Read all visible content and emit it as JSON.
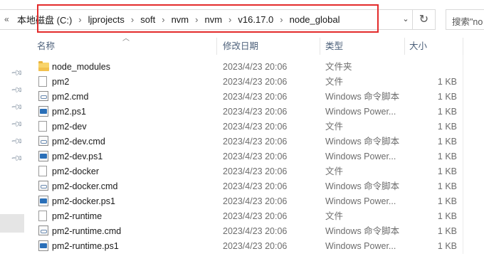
{
  "address_bar": {
    "overflow_glyph": "«",
    "crumbs": [
      "本地磁盘 (C:)",
      "ljprojects",
      "soft",
      "nvm",
      "nvm",
      "v16.17.0",
      "node_global"
    ],
    "separator": "›",
    "dropdown_glyph": "⌄",
    "refresh_glyph": "↻"
  },
  "search": {
    "placeholder": "搜索\"no"
  },
  "columns": {
    "name": "名称",
    "date": "修改日期",
    "type": "类型",
    "size": "大小"
  },
  "files": [
    {
      "name": "node_modules",
      "date": "2023/4/23 20:06",
      "type": "文件夹",
      "size": "",
      "icon": "folder-icon"
    },
    {
      "name": "pm2",
      "date": "2023/4/23 20:06",
      "type": "文件",
      "size": "1 KB",
      "icon": "file-icon"
    },
    {
      "name": "pm2.cmd",
      "date": "2023/4/23 20:06",
      "type": "Windows 命令脚本",
      "size": "1 KB",
      "icon": "cmd-script-icon"
    },
    {
      "name": "pm2.ps1",
      "date": "2023/4/23 20:06",
      "type": "Windows Power...",
      "size": "1 KB",
      "icon": "powershell-icon"
    },
    {
      "name": "pm2-dev",
      "date": "2023/4/23 20:06",
      "type": "文件",
      "size": "1 KB",
      "icon": "file-icon"
    },
    {
      "name": "pm2-dev.cmd",
      "date": "2023/4/23 20:06",
      "type": "Windows 命令脚本",
      "size": "1 KB",
      "icon": "cmd-script-icon"
    },
    {
      "name": "pm2-dev.ps1",
      "date": "2023/4/23 20:06",
      "type": "Windows Power...",
      "size": "1 KB",
      "icon": "powershell-icon"
    },
    {
      "name": "pm2-docker",
      "date": "2023/4/23 20:06",
      "type": "文件",
      "size": "1 KB",
      "icon": "file-icon"
    },
    {
      "name": "pm2-docker.cmd",
      "date": "2023/4/23 20:06",
      "type": "Windows 命令脚本",
      "size": "1 KB",
      "icon": "cmd-script-icon"
    },
    {
      "name": "pm2-docker.ps1",
      "date": "2023/4/23 20:06",
      "type": "Windows Power...",
      "size": "1 KB",
      "icon": "powershell-icon"
    },
    {
      "name": "pm2-runtime",
      "date": "2023/4/23 20:06",
      "type": "文件",
      "size": "1 KB",
      "icon": "file-icon"
    },
    {
      "name": "pm2-runtime.cmd",
      "date": "2023/4/23 20:06",
      "type": "Windows 命令脚本",
      "size": "1 KB",
      "icon": "cmd-script-icon"
    },
    {
      "name": "pm2-runtime.ps1",
      "date": "2023/4/23 20:06",
      "type": "Windows Power...",
      "size": "1 KB",
      "icon": "powershell-icon"
    }
  ],
  "colors": {
    "highlight": "#e32b2b",
    "header_text": "#4c607a",
    "folder": "#f8d46b"
  }
}
